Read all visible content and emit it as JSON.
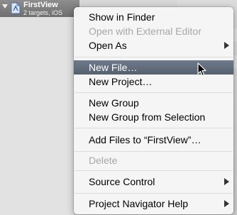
{
  "navigator": {
    "project_name": "FirstView",
    "project_subtitle": "2 targets, iOS"
  },
  "context_menu": {
    "items": [
      {
        "label": "Show in Finder",
        "enabled": true
      },
      {
        "label": "Open with External Editor",
        "enabled": false
      },
      {
        "label": "Open As",
        "enabled": true,
        "submenu": true
      },
      {
        "label": "New File…",
        "enabled": true,
        "highlighted": true
      },
      {
        "label": "New Project…",
        "enabled": true
      },
      {
        "label": "New Group",
        "enabled": true
      },
      {
        "label": "New Group from Selection",
        "enabled": true
      },
      {
        "label": "Add Files to “FirstView”…",
        "enabled": true
      },
      {
        "label": "Delete",
        "enabled": false
      },
      {
        "label": "Source Control",
        "enabled": true,
        "submenu": true
      },
      {
        "label": "Project Navigator Help",
        "enabled": true,
        "submenu": true
      }
    ]
  },
  "colors": {
    "highlight": "#5f6a7a",
    "disabled_text": "#a7a7a7",
    "selected_row": "#7d7d7d"
  },
  "icons": {
    "project": "xcode-project-icon",
    "disclosure": "disclosure-triangle-icon",
    "submenu": "submenu-arrow-icon",
    "cursor": "mouse-pointer-icon"
  }
}
